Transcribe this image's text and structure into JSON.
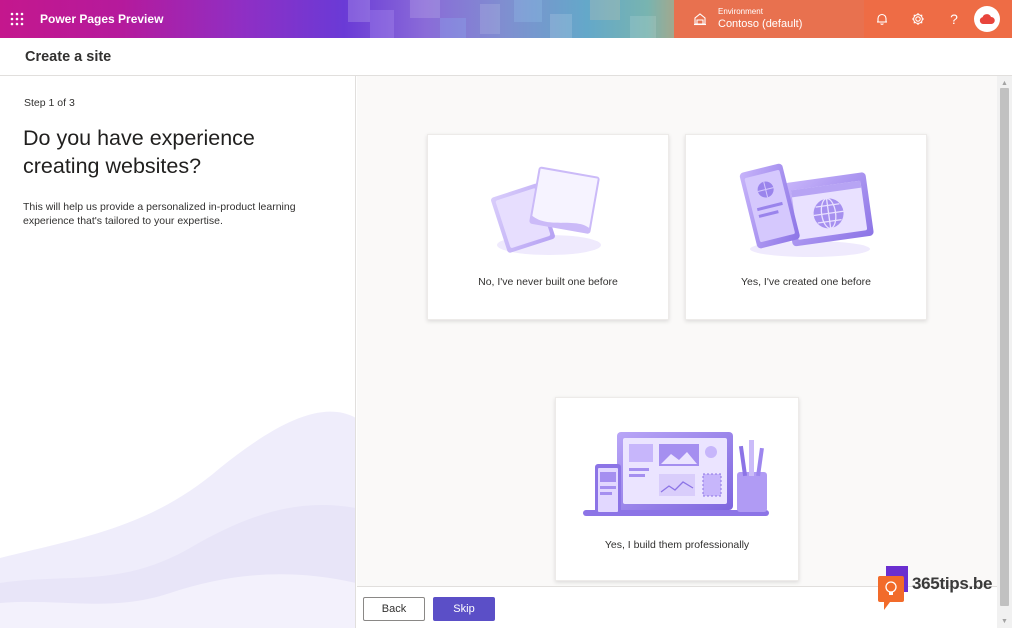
{
  "app": {
    "title": "Power Pages Preview",
    "environment_label": "Environment",
    "environment_value": "Contoso (default)",
    "help_glyph": "?",
    "brand_colors": {
      "accent": "#5b4fc7",
      "env_bar": "#e8714f",
      "icons_bar": "#ee6c45"
    }
  },
  "page": {
    "title": "Create a site"
  },
  "wizard": {
    "step": "Step 1 of 3",
    "question": "Do you have experience creating websites?",
    "helper": "This will help us provide a personalized in-product learning experience that's tailored to your expertise."
  },
  "options": [
    {
      "label": "No, I've never built one before",
      "icon": "blank-pages-illustration"
    },
    {
      "label": "Yes, I've created one before",
      "icon": "globe-pages-illustration"
    },
    {
      "label": "Yes, I build them professionally",
      "icon": "laptop-design-illustration"
    }
  ],
  "footer": {
    "back_label": "Back",
    "skip_label": "Skip"
  },
  "watermark": {
    "text": "365tips.be"
  },
  "icons": {
    "waffle": "waffle-icon",
    "environment": "environment-icon",
    "bell": "bell-icon",
    "settings": "gear-icon",
    "help": "help-icon",
    "avatar": "cloud-avatar-icon"
  }
}
